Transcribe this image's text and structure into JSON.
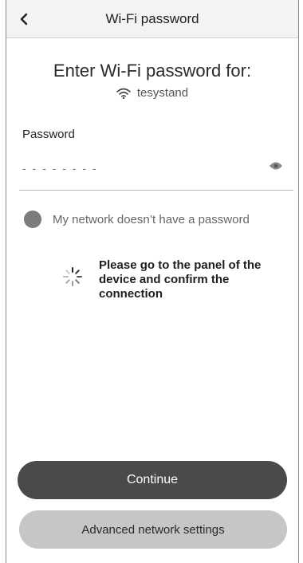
{
  "header": {
    "title": "Wi-Fi password",
    "back_icon": "chevron-left-icon"
  },
  "main": {
    "heading": "Enter Wi-Fi password for:",
    "network_name": "tesystand",
    "network_icon": "wifi-icon",
    "password_label": "Password",
    "password_value": "- - - - - - - -",
    "eye_icon": "eye-icon",
    "no_password_label": "My network doesn’t have a password",
    "confirm_message": "Please go to the panel of the device and confirm the connection",
    "spinner_icon": "spinner-icon"
  },
  "buttons": {
    "continue_label": "Continue",
    "advanced_label": "Advanced network settings"
  },
  "colors": {
    "continue_bg": "#4a4a4a",
    "advanced_bg": "#c6c6c6",
    "header_bg": "#f3f3f3",
    "toggle_dot": "#7c7c7c"
  }
}
